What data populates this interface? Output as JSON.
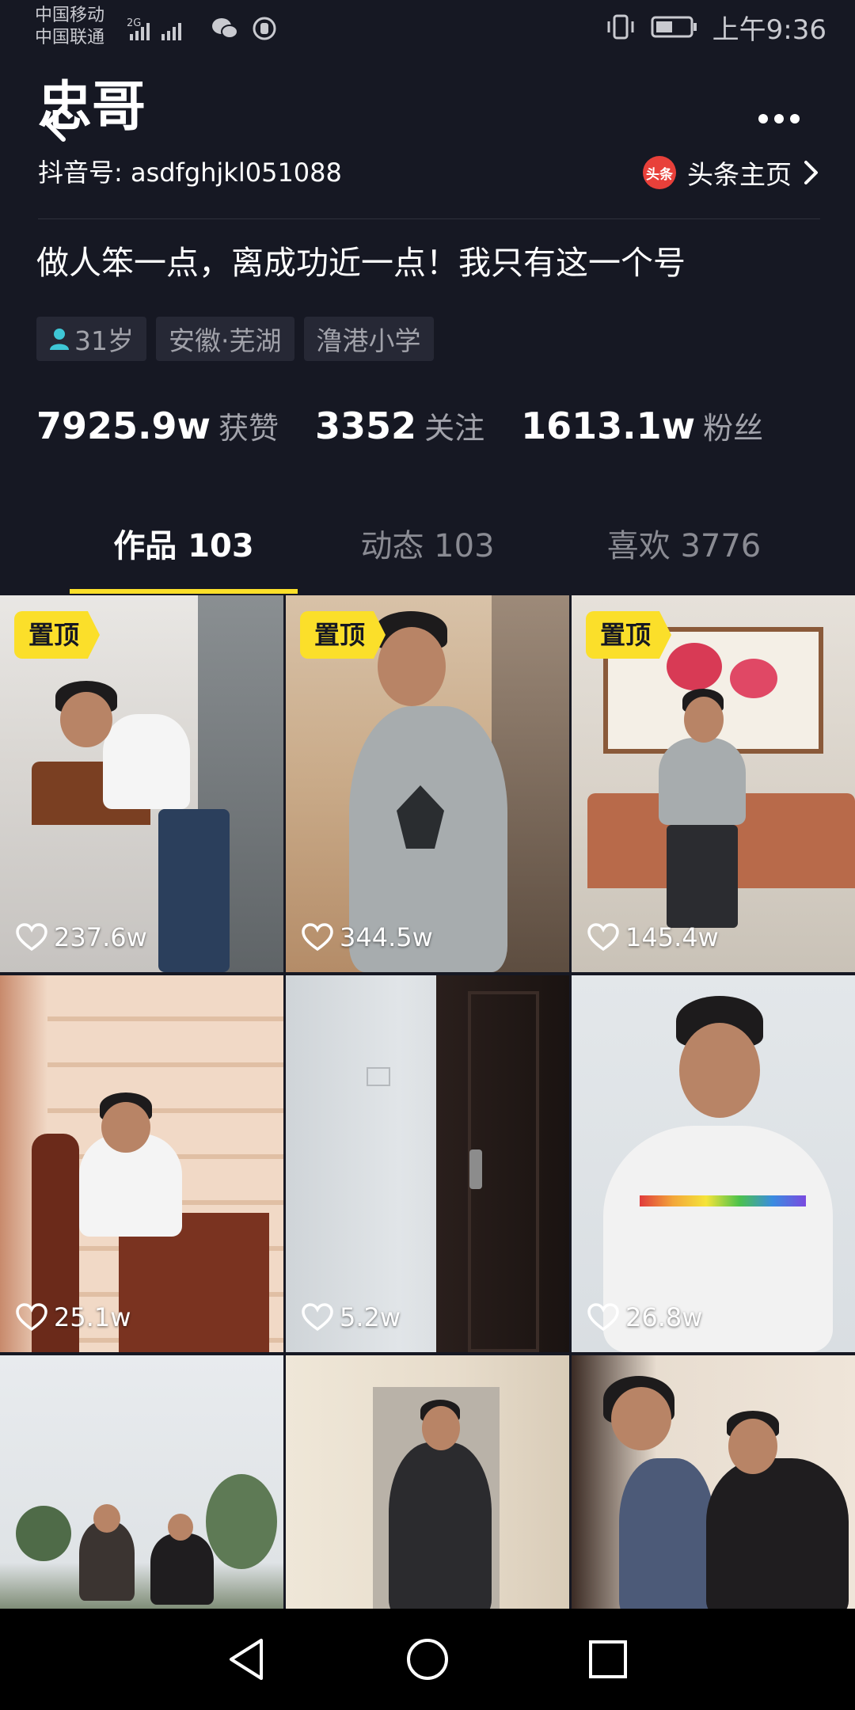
{
  "status_bar": {
    "carrier_1": "中国移动",
    "carrier_2": "中国联通",
    "network": "2G",
    "time": "上午9:36"
  },
  "profile": {
    "nickname": "忠哥",
    "id_label": "抖音号: asdfghjkl051088",
    "toutiao_badge": "头条",
    "toutiao_link": "头条主页",
    "signature": "做人笨一点，离成功近一点！我只有这一个号",
    "tags": [
      "31岁",
      "安徽·芜湖",
      "澛港小学"
    ],
    "stats": [
      {
        "value": "7925.9w",
        "label": "获赞"
      },
      {
        "value": "3352",
        "label": "关注"
      },
      {
        "value": "1613.1w",
        "label": "粉丝"
      }
    ]
  },
  "tabs": [
    {
      "label": "作品 103",
      "active": true
    },
    {
      "label": "动态 103",
      "active": false
    },
    {
      "label": "喜欢 3776",
      "active": false
    }
  ],
  "videos": [
    {
      "pinned": "置顶",
      "likes": "237.6w"
    },
    {
      "pinned": "置顶",
      "likes": "344.5w"
    },
    {
      "pinned": "置顶",
      "likes": "145.4w"
    },
    {
      "pinned": "",
      "likes": "25.1w"
    },
    {
      "pinned": "",
      "likes": "5.2w"
    },
    {
      "pinned": "",
      "likes": "26.8w"
    },
    {
      "pinned": "",
      "likes": ""
    },
    {
      "pinned": "",
      "likes": ""
    },
    {
      "pinned": "",
      "likes": ""
    }
  ],
  "colors": {
    "background": "#161823",
    "accent": "#fbdf2a",
    "secondary_text": "#a1a2aa"
  },
  "icons": [
    "back-arrow-icon",
    "more-dots-icon",
    "toutiao-icon",
    "chevron-right-icon",
    "person-icon",
    "heart-icon",
    "nav-back-icon",
    "nav-home-icon",
    "nav-recents-icon"
  ]
}
